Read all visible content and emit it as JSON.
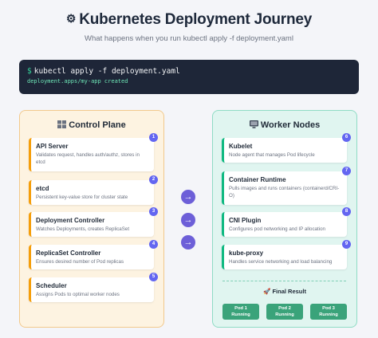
{
  "header": {
    "title_icon": "⚙",
    "title": "Kubernetes Deployment Journey",
    "subtitle": "What happens when you run kubectl apply -f deployment.yaml"
  },
  "terminal": {
    "prompt": "$",
    "command": "kubectl apply -f deployment.yaml",
    "output": "deployment.apps/my-app created"
  },
  "control_plane": {
    "title": "Control Plane",
    "icon": "grid-icon",
    "components": [
      {
        "step": "1",
        "name": "API Server",
        "description": "Validates request, handles auth/authz, stores in etcd"
      },
      {
        "step": "2",
        "name": "etcd",
        "description": "Persistent key-value store for cluster state"
      },
      {
        "step": "3",
        "name": "Deployment Controller",
        "description": "Watches Deployments, creates ReplicaSet"
      },
      {
        "step": "4",
        "name": "ReplicaSet Controller",
        "description": "Ensures desired number of Pod replicas"
      },
      {
        "step": "5",
        "name": "Scheduler",
        "description": "Assigns Pods to optimal worker nodes"
      }
    ]
  },
  "flow_arrows": [
    "→",
    "→",
    "→"
  ],
  "worker_nodes": {
    "title": "Worker Nodes",
    "icon": "monitor-icon",
    "components": [
      {
        "step": "6",
        "name": "Kubelet",
        "description": "Node agent that manages Pod lifecycle"
      },
      {
        "step": "7",
        "name": "Container Runtime",
        "description": "Pulls images and runs containers (containerd/CRI-O)"
      },
      {
        "step": "8",
        "name": "CNI Plugin",
        "description": "Configures pod networking and IP allocation"
      },
      {
        "step": "9",
        "name": "kube-proxy",
        "description": "Handles service networking and load balancing"
      }
    ],
    "final_result": {
      "icon": "🚀",
      "title": "Final Result",
      "pods": [
        {
          "name": "Pod 1",
          "status": "Running"
        },
        {
          "name": "Pod 2",
          "status": "Running"
        },
        {
          "name": "Pod 3",
          "status": "Running"
        }
      ]
    }
  },
  "colors": {
    "control_bg": "#fdf3e1",
    "control_border": "#f2c98c",
    "control_accent": "#f59e0b",
    "worker_bg": "#e0f5f0",
    "worker_border": "#8fdcc5",
    "worker_accent": "#10b981",
    "badge": "#6366f1",
    "arrow": "#6d5fd8",
    "pod": "#3aa37a",
    "terminal_bg": "#1e2638"
  }
}
